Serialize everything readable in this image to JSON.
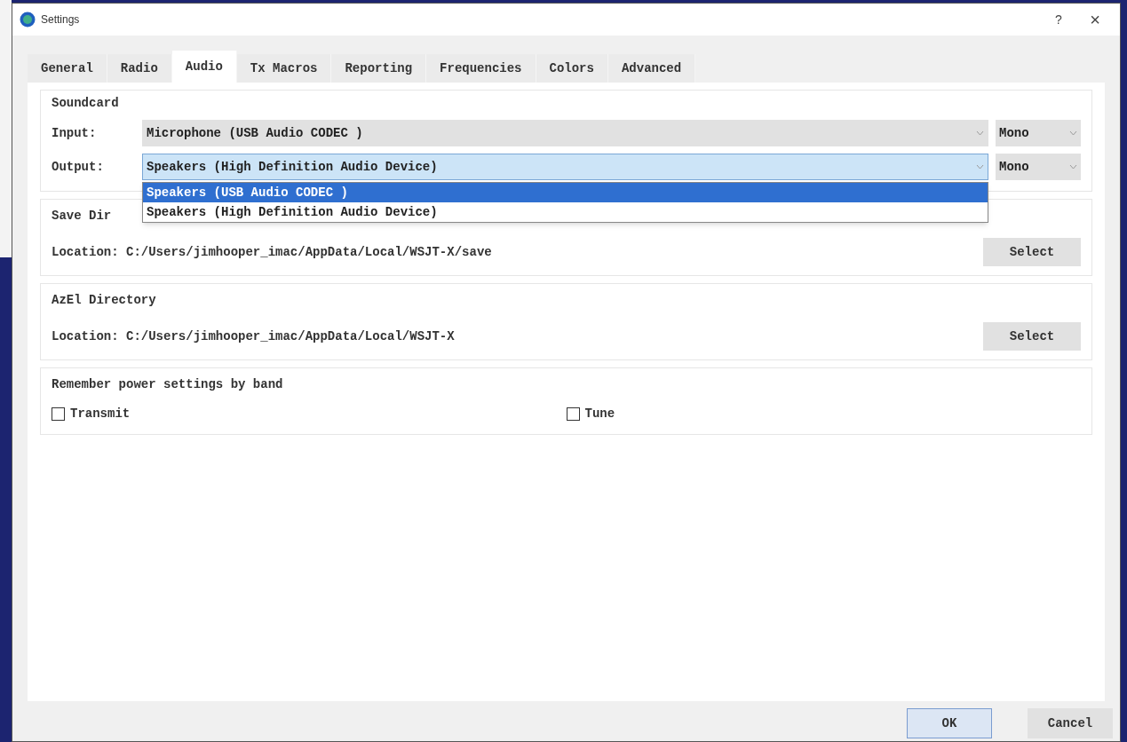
{
  "window": {
    "title": "Settings",
    "help": "?",
    "close": "×"
  },
  "tabs": [
    {
      "label": "General",
      "selected": false
    },
    {
      "label": "Radio",
      "selected": false
    },
    {
      "label": "Audio",
      "selected": true
    },
    {
      "label": "Tx Macros",
      "selected": false
    },
    {
      "label": "Reporting",
      "selected": false
    },
    {
      "label": "Frequencies",
      "selected": false
    },
    {
      "label": "Colors",
      "selected": false
    },
    {
      "label": "Advanced",
      "selected": false
    }
  ],
  "soundcard": {
    "title": "Soundcard",
    "rows": [
      {
        "label": "Input:",
        "device": "Microphone (USB Audio CODEC )",
        "channel": "Mono",
        "focused": false
      },
      {
        "label": "Output:",
        "device": "Speakers (High Definition Audio Device)",
        "channel": "Mono",
        "focused": true
      }
    ]
  },
  "dropdown": {
    "options": [
      {
        "label": "Speakers (USB Audio CODEC )",
        "selected": true
      },
      {
        "label": "Speakers (High Definition Audio Device)",
        "selected": false
      }
    ]
  },
  "save_directory": {
    "title": "Save Dir",
    "location": "Location: C:/Users/jimhooper_imac/AppData/Local/WSJT-X/save",
    "button": "Select"
  },
  "azel_directory": {
    "title": "AzEl Directory",
    "location": "Location: C:/Users/jimhooper_imac/AppData/Local/WSJT-X",
    "button": "Select"
  },
  "power": {
    "title": "Remember power settings by band",
    "options": [
      {
        "label": "Transmit",
        "checked": false
      },
      {
        "label": "Tune",
        "checked": false
      }
    ]
  },
  "buttons": [
    {
      "label": "OK",
      "default": true
    },
    {
      "label": "Cancel",
      "default": false
    }
  ]
}
